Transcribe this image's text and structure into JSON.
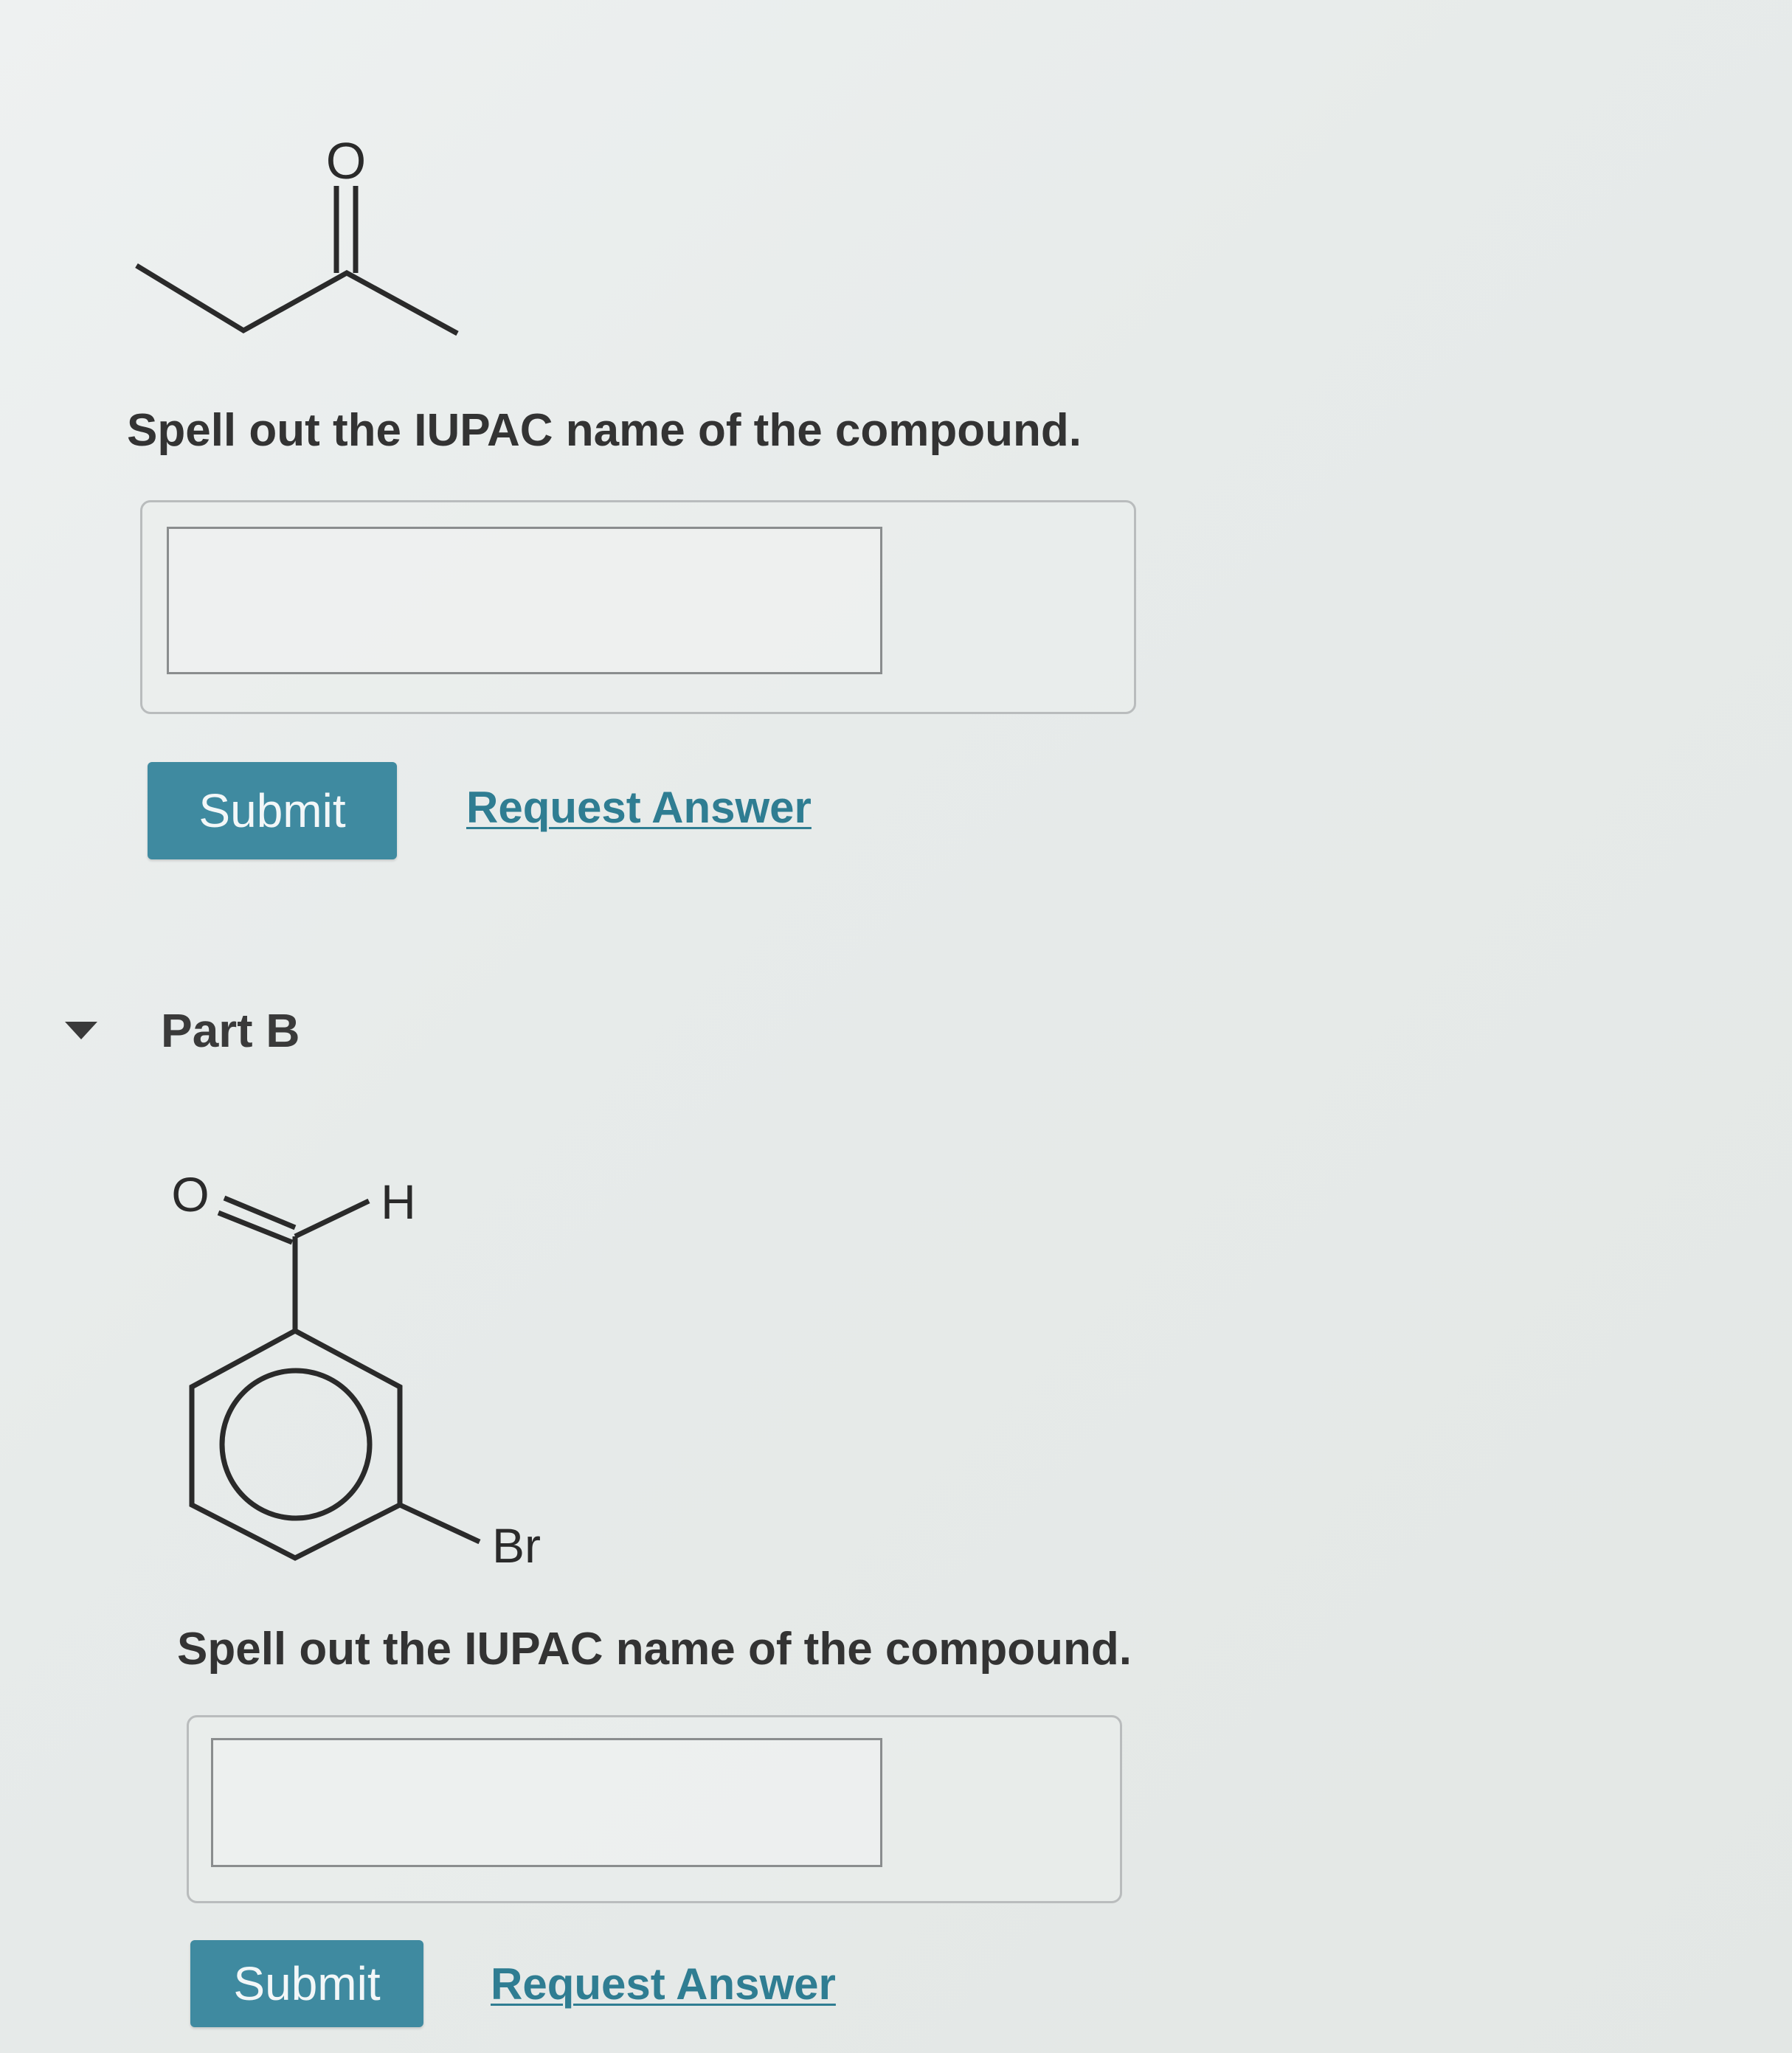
{
  "part_a": {
    "molecule_labels": {
      "oxygen": "O"
    },
    "prompt": "Spell out the IUPAC name of the compound.",
    "input_value": "",
    "submit_label": "Submit",
    "request_answer_label": "Request Answer"
  },
  "part_b": {
    "title": "Part B",
    "molecule_labels": {
      "oxygen": "O",
      "hydrogen": "H",
      "bromine": "Br"
    },
    "prompt": "Spell out the IUPAC name of the compound.",
    "input_value": "",
    "submit_label": "Submit",
    "request_answer_label": "Request Answer"
  },
  "colors": {
    "button": "#3f8aa0",
    "link": "#2f7d92",
    "text": "#333333"
  },
  "icons": {
    "collapse_toggle": "caret-down-icon"
  }
}
